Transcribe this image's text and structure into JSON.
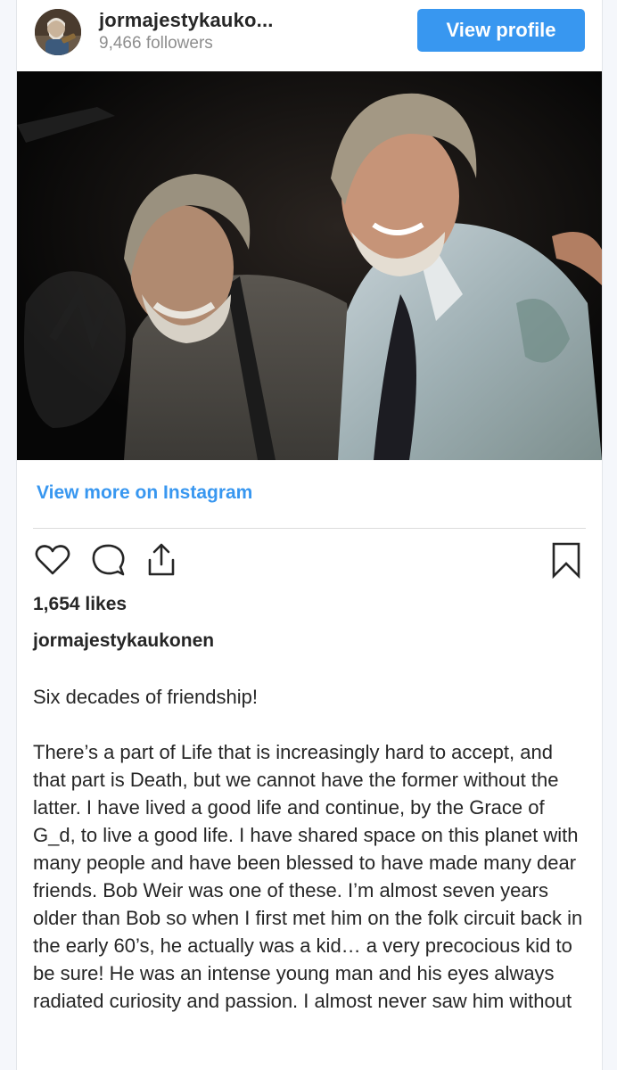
{
  "header": {
    "username": "jormajestykauko...",
    "followers": "9,466 followers",
    "view_profile_label": "View profile"
  },
  "post": {
    "image_alt": "Two older men with gray hair and beards embracing on stage",
    "view_more_label": "View more on Instagram",
    "likes": "1,654 likes",
    "author": "jormajestykaukonen",
    "caption_intro": "Six decades of friendship!",
    "caption_body": "There’s a part of Life that is increasingly hard to accept, and that part is Death, but we cannot have the former without the latter. I have lived a good life and continue, by the Grace of G_d, to live a good life. I have shared space on this planet with many people and have been blessed to have made many dear friends. Bob Weir was one of these. I’m almost seven years older than Bob so when I first met him on the folk circuit back in the early 60’s, he actually was a kid… a very precocious kid to be sure! He was an intense young man and his eyes always radiated curiosity and passion. I almost never saw him without"
  },
  "actions": {
    "like_icon": "heart-outline-icon",
    "comment_icon": "comment-bubble-icon",
    "share_icon": "share-upload-icon",
    "save_icon": "bookmark-outline-icon"
  },
  "colors": {
    "accent": "#3897f0",
    "text": "#262626",
    "muted": "#8e8e8e",
    "divider": "#dbdbdb"
  }
}
